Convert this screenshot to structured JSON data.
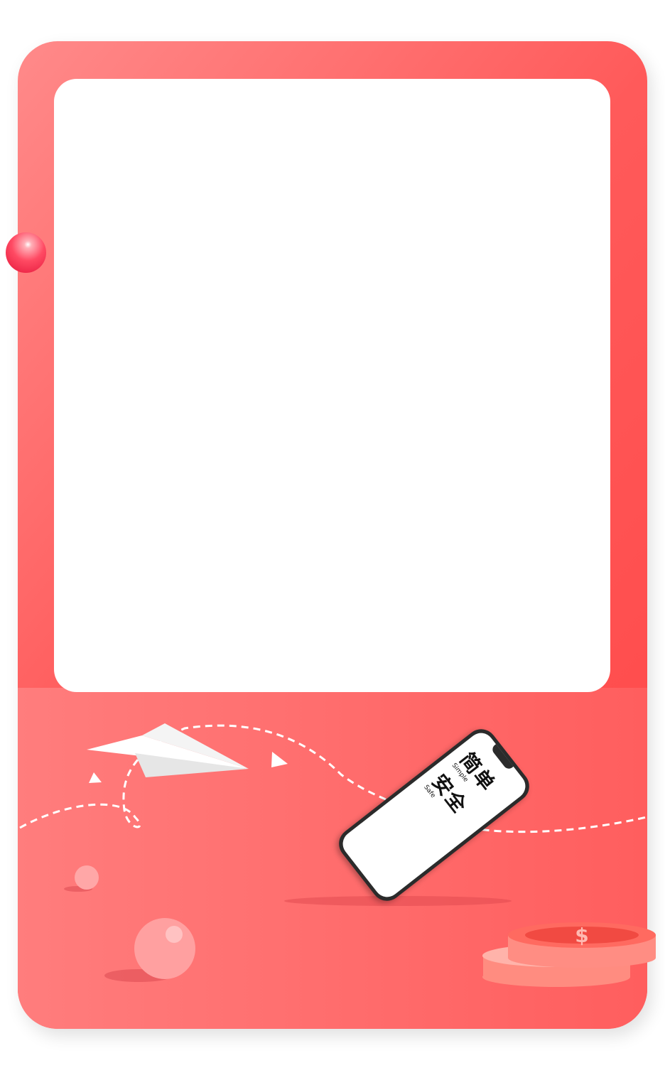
{
  "colors": {
    "card": "#ff5a5a",
    "panel": "#ffffff",
    "ball": "#ff4a63"
  },
  "phone": {
    "line1_cn": "简单",
    "line1_en": "Simple",
    "line2_cn": "安全",
    "line2_en": "Safe"
  },
  "coin": {
    "symbol": "$"
  }
}
